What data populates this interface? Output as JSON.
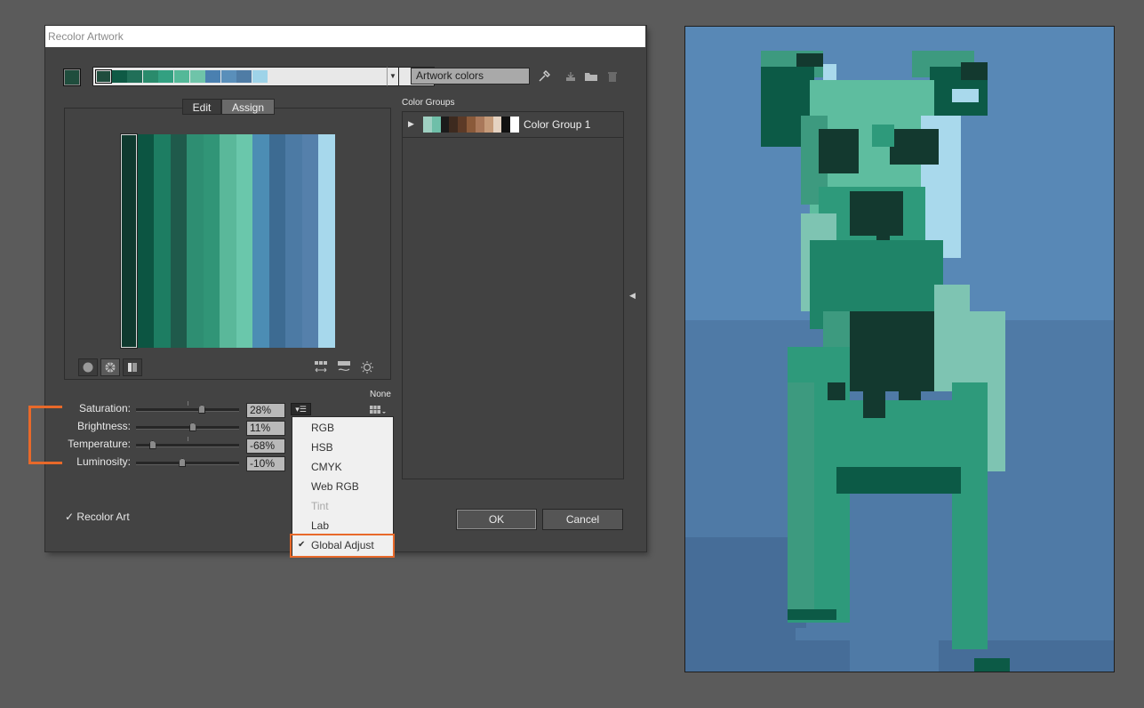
{
  "dialog": {
    "title": "Recolor Artwork",
    "artwork_colors": "Artwork colors",
    "tabs": {
      "edit": "Edit",
      "assign": "Assign"
    },
    "harmony_swatches": [
      "#1f4d3d",
      "#0f5a45",
      "#216f58",
      "#2a8b6c",
      "#33a081",
      "#54b898",
      "#6fc4a9",
      "#4a80b0",
      "#5a8fba",
      "#4f7ca5",
      "#9ed3e8"
    ],
    "stripes": [
      "#0f3a2f",
      "#0c5542",
      "#1d7d62",
      "#1f5a4b",
      "#2e8e72",
      "#319577",
      "#5ab89a",
      "#6ac7ab",
      "#4c8db4",
      "#3d6b92",
      "#4c7aa4",
      "#5580ab",
      "#a7d8ec"
    ],
    "sliders": [
      {
        "label": "Saturation:",
        "value": "28%",
        "pos": 0.64
      },
      {
        "label": "Brightness:",
        "value": "11%",
        "pos": 0.55
      },
      {
        "label": "Temperature:",
        "value": "-68%",
        "pos": 0.16
      },
      {
        "label": "Luminosity:",
        "value": "-10%",
        "pos": 0.45
      }
    ],
    "none_label": "None",
    "menu": [
      {
        "label": "RGB",
        "disabled": false,
        "checked": false
      },
      {
        "label": "HSB",
        "disabled": false,
        "checked": false
      },
      {
        "label": "CMYK",
        "disabled": false,
        "checked": false
      },
      {
        "label": "Web RGB",
        "disabled": false,
        "checked": false
      },
      {
        "label": "Tint",
        "disabled": true,
        "checked": false
      },
      {
        "label": "Lab",
        "disabled": false,
        "checked": false
      },
      {
        "label": "Global Adjust",
        "disabled": false,
        "checked": true
      }
    ],
    "color_groups_label": "Color Groups",
    "color_group": {
      "name": "Color Group 1",
      "swatches": [
        "#9fd0c2",
        "#6fbfa9",
        "#1b1b1b",
        "#3d2a1f",
        "#5c3a27",
        "#8a5a3a",
        "#a9785a",
        "#c59b7a",
        "#e5d3c2",
        "#111111",
        "#ffffff"
      ]
    },
    "recolor_art": "Recolor Art",
    "ok": "OK",
    "cancel": "Cancel"
  },
  "artwork": {
    "bg_top": "#5888b6",
    "bg_bottom": "#4f7aa6",
    "bg_floor": "#466d98"
  },
  "colors": {
    "accent": "#e8692a"
  }
}
